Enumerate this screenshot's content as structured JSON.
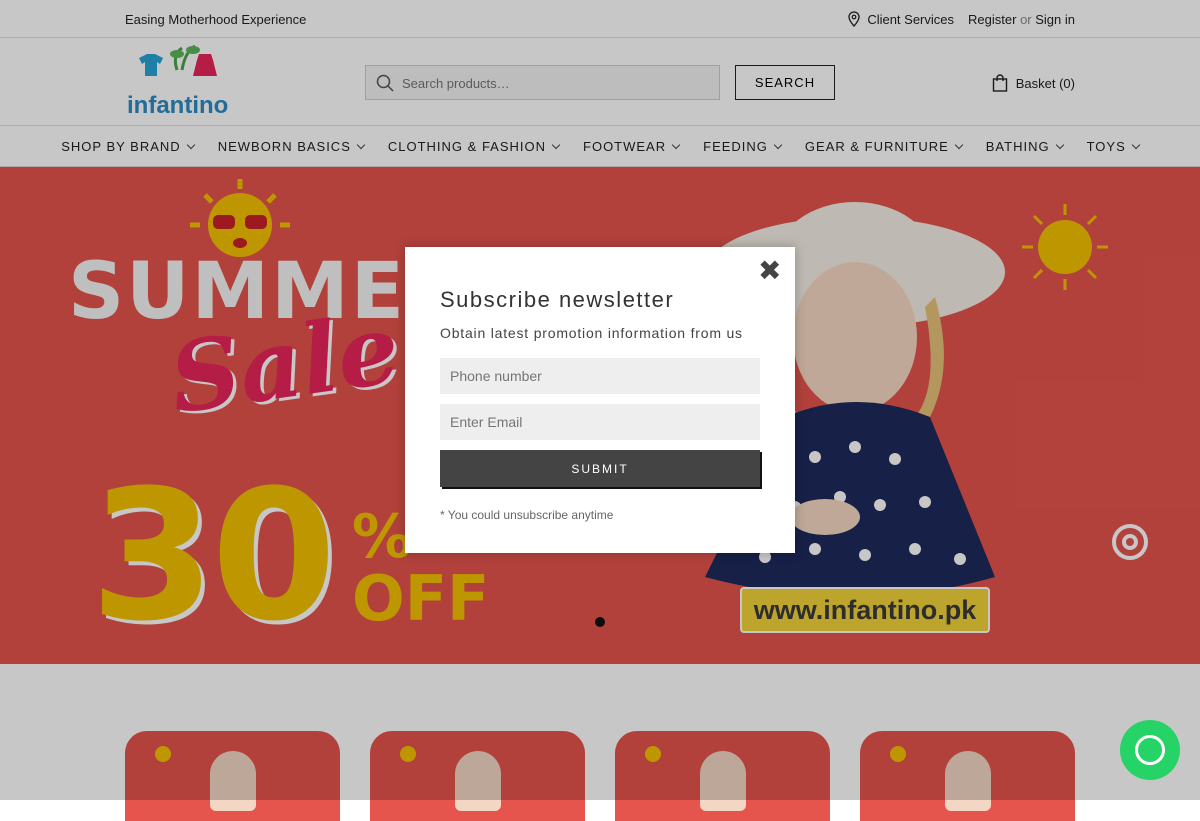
{
  "topbar": {
    "tagline": "Easing Motherhood Experience",
    "client_services": "Client Services",
    "register": "Register",
    "or": "or",
    "sign_in": "Sign in"
  },
  "header": {
    "logo_text": "infantino",
    "search_placeholder": "Search products…",
    "search_button": "SEARCH",
    "basket": "Basket (0)"
  },
  "nav": {
    "items": [
      {
        "label": "SHOP BY BRAND"
      },
      {
        "label": "NEWBORN BASICS"
      },
      {
        "label": "CLOTHING & FASHION"
      },
      {
        "label": "FOOTWEAR"
      },
      {
        "label": "FEEDING"
      },
      {
        "label": "GEAR & FURNITURE"
      },
      {
        "label": "BATHING"
      },
      {
        "label": "TOYS"
      }
    ]
  },
  "hero": {
    "line1": "SUMMER",
    "line2": "Sale",
    "discount": "30",
    "percent": "%",
    "off": "OFF",
    "url": "www.infantino.pk",
    "colors": {
      "background": "#e5544d",
      "accent": "#f4c200",
      "sale": "#e8245a"
    }
  },
  "modal": {
    "close": "✖",
    "title": "Subscribe newsletter",
    "subtitle": "Obtain latest promotion information from us",
    "phone_placeholder": "Phone number",
    "email_placeholder": "Enter Email",
    "submit": "SUBMIT",
    "note": "* You could unsubscribe anytime"
  },
  "icons": {
    "client_services": "location-pin-icon",
    "search": "search-icon",
    "basket": "shopping-bag-icon",
    "whatsapp": "whatsapp-icon"
  }
}
